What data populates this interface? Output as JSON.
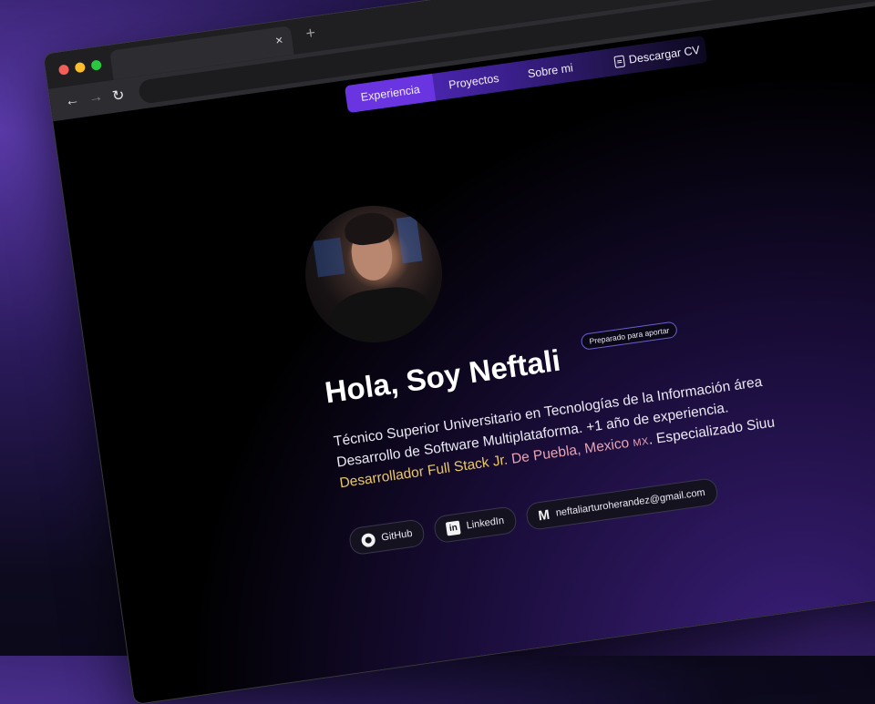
{
  "browser": {
    "tab_close": "×",
    "new_tab": "+",
    "nav_back": "←",
    "nav_forward": "→",
    "nav_reload": "↻"
  },
  "nav": {
    "items": [
      {
        "label": "Experiencia",
        "active": true
      },
      {
        "label": "Proyectos",
        "active": false
      },
      {
        "label": "Sobre mi",
        "active": false
      }
    ],
    "cv_label": "Descargar CV"
  },
  "hero": {
    "title": "Hola, Soy Neftali",
    "badge": "Preparado para aportar",
    "bio_part1": "Técnico Superior Universitario en Tecnologías de la Información área Desarrollo de Software Multiplataforma. +1 año de experiencia. ",
    "bio_highlight_role": "Desarrollador Full Stack Jr.",
    "bio_highlight_location": "De Puebla, Mexico",
    "bio_country": "MX",
    "bio_part2": ". Especializado Siuu"
  },
  "social": {
    "github": "GitHub",
    "linkedin": "LinkedIn",
    "email": "neftaliarturoherandez@gmail.com"
  },
  "colors": {
    "accent_purple": "#6a35e0",
    "highlight_yellow": "#e8c86a",
    "highlight_pink": "#e7a4b4"
  }
}
